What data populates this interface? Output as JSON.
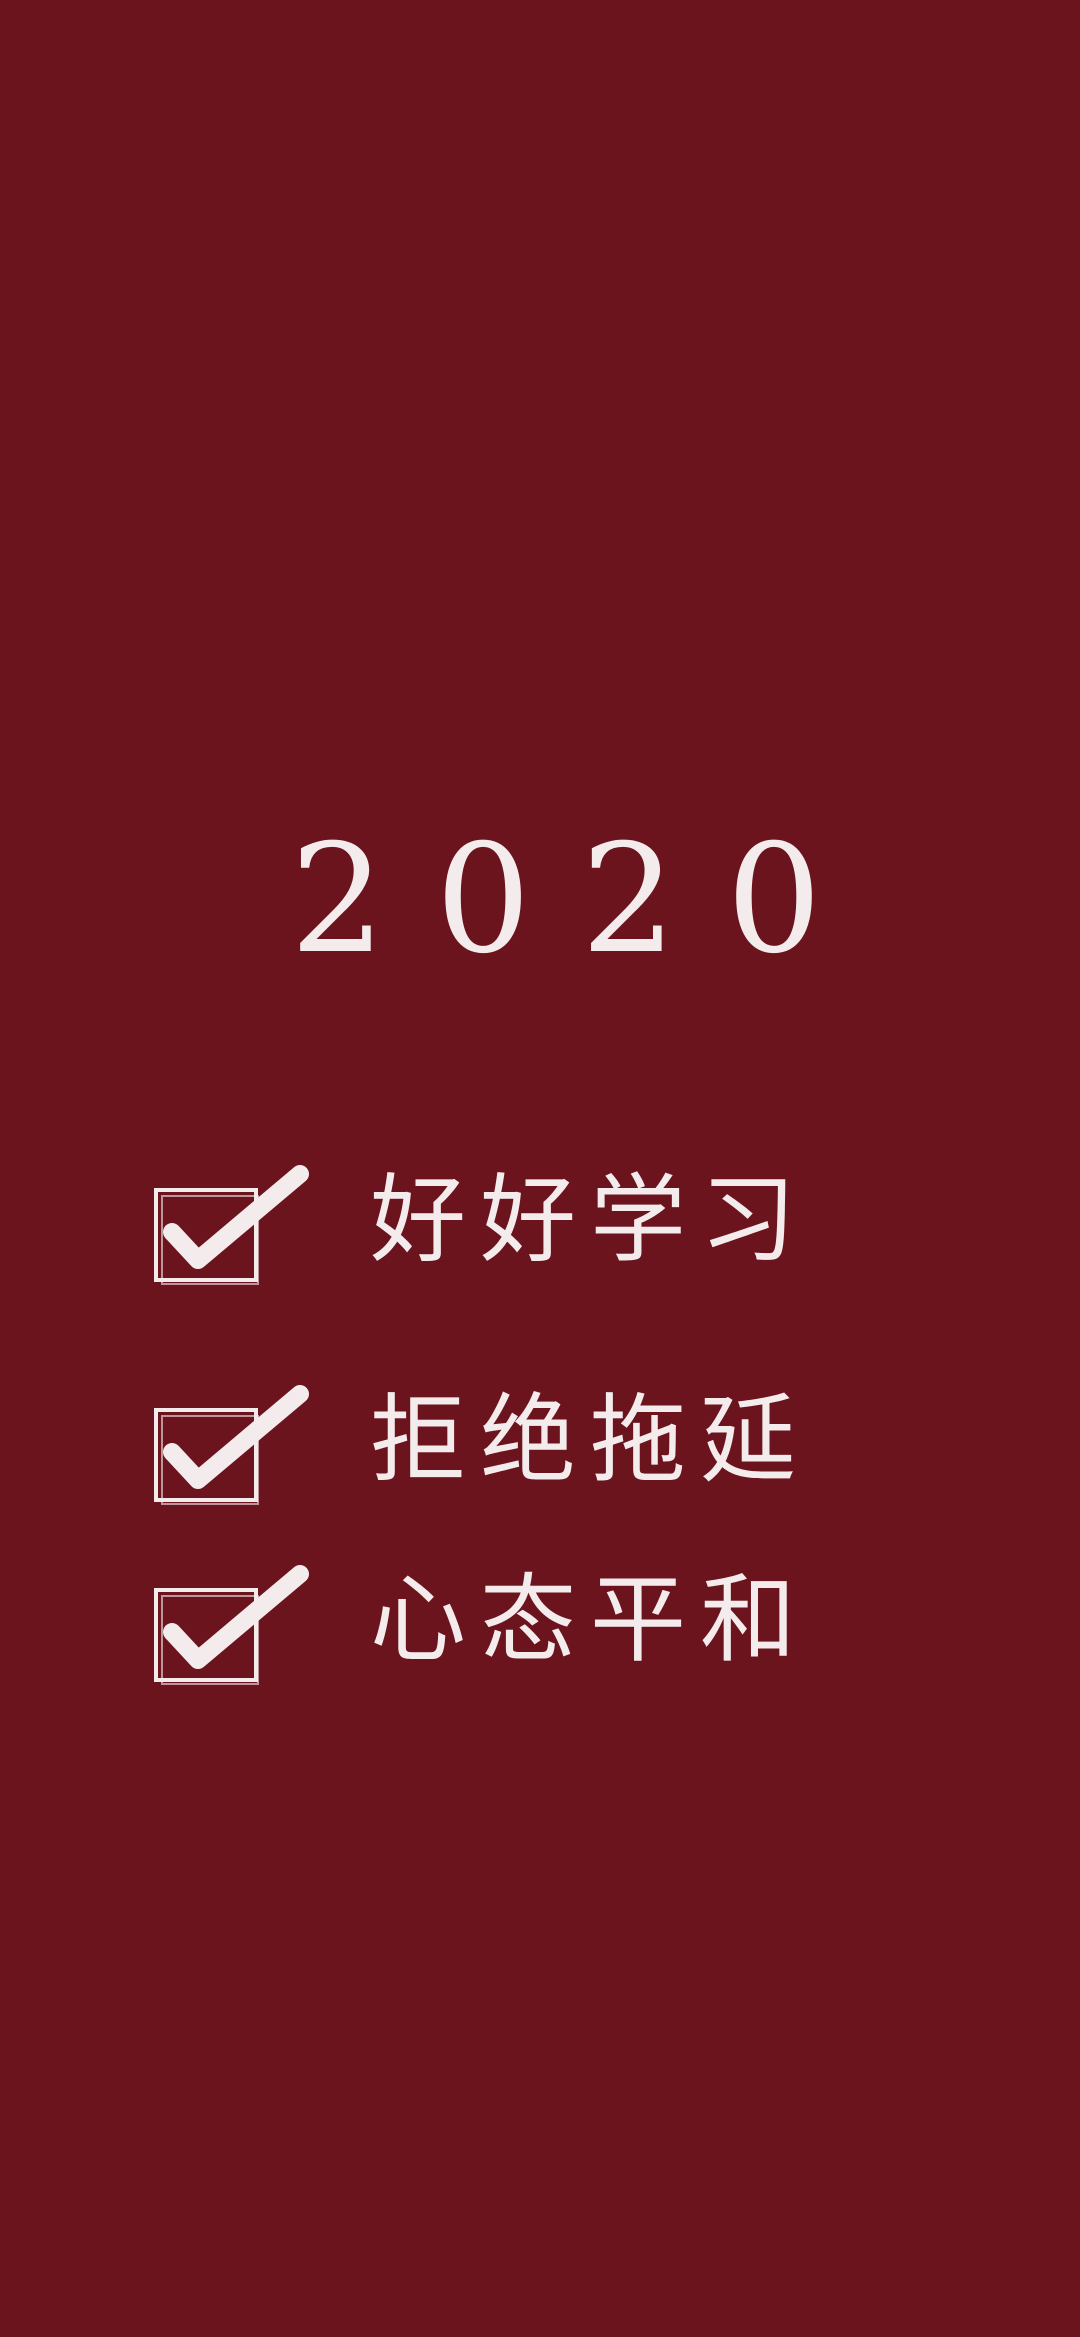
{
  "wallpaper": {
    "background_color": "#6b141e",
    "text_color": "#f4ecec"
  },
  "year": "2020",
  "goals": [
    {
      "text": "好好学习",
      "checked": true,
      "icon": "checkbox-checked-icon"
    },
    {
      "text": "拒绝拖延",
      "checked": true,
      "icon": "checkbox-checked-icon"
    },
    {
      "text": "心态平和",
      "checked": true,
      "icon": "checkbox-checked-icon"
    }
  ]
}
